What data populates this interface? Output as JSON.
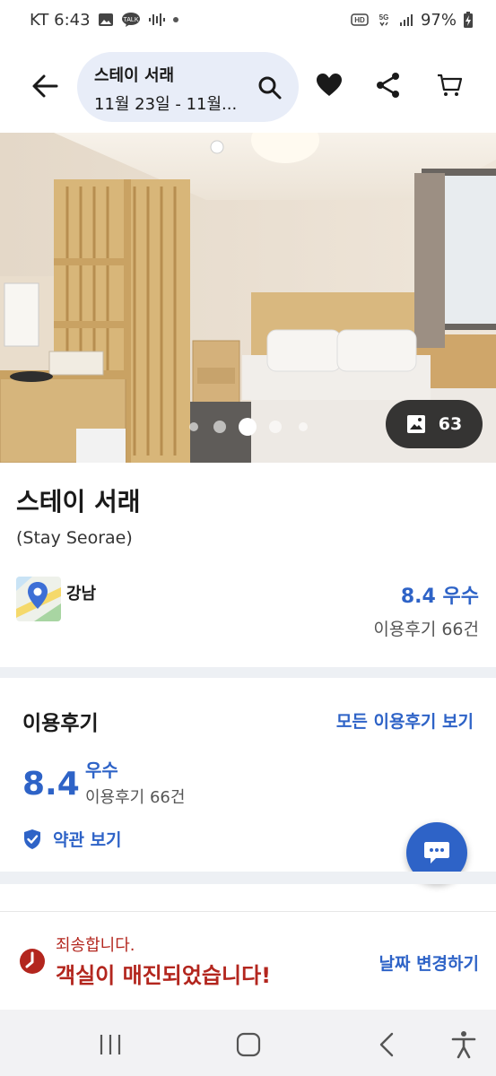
{
  "status_bar": {
    "carrier_time": "KT 6:43",
    "battery": "97%"
  },
  "header": {
    "property_name": "스테이 서래",
    "date_range": "11월 23일 - 11월..."
  },
  "hero": {
    "photo_count": "63",
    "slide_index": 3,
    "slide_total": 5
  },
  "info": {
    "name": "스테이 서래",
    "english_name": "(Stay Seorae)",
    "area": "강남",
    "score_text": "8.4 우수",
    "review_count": "이용후기 66건"
  },
  "reviews": {
    "title": "이용후기",
    "view_all": "모든 이용후기 보기",
    "score": "8.4",
    "grade": "우수",
    "count": "이용후기 66건",
    "terms": "약관 보기"
  },
  "sold_out": {
    "sorry": "죄송합니다.",
    "message": "객실이 매진되었습니다!",
    "change_date": "날짜 변경하기"
  },
  "colors": {
    "accent": "#2e63c7",
    "alert": "#b3261e",
    "pill_bg": "#e8edf8"
  }
}
